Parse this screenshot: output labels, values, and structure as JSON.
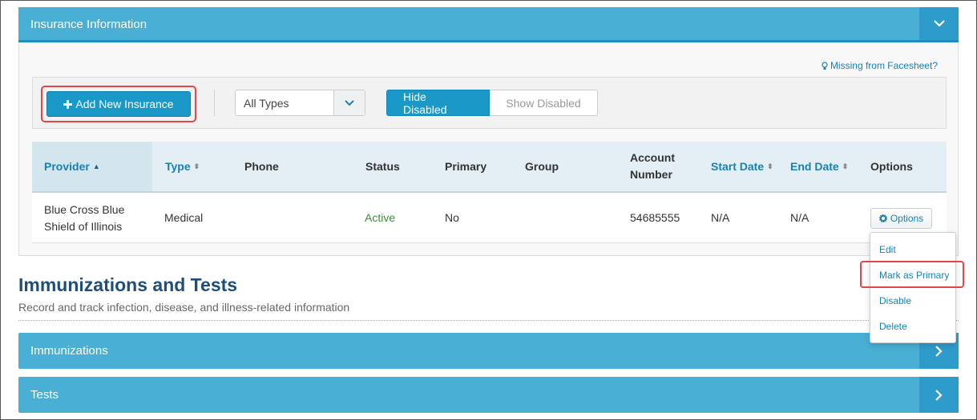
{
  "insurance_panel": {
    "title": "Insurance Information",
    "collapse_icon": "chevron-down-icon",
    "missing_link": "Missing from Facesheet?",
    "add_button_label": "Add New Insurance",
    "type_filter": {
      "selected": "All Types"
    },
    "toggle": {
      "hide_label": "Hide Disabled",
      "show_label": "Show Disabled",
      "active": "hide"
    }
  },
  "insurance_table": {
    "headers": {
      "provider": "Provider",
      "type": "Type",
      "phone": "Phone",
      "status": "Status",
      "primary": "Primary",
      "group": "Group",
      "account_number": "Account Number",
      "start_date": "Start Date",
      "end_date": "End Date",
      "options": "Options"
    },
    "rows": [
      {
        "provider": "Blue Cross Blue Shield of Illinois",
        "type": "Medical",
        "phone": "",
        "status": "Active",
        "primary": "No",
        "group": "",
        "account_number": "54685555",
        "start_date": "N/A",
        "end_date": "N/A",
        "options_label": "Options"
      }
    ]
  },
  "options_menu": {
    "items": [
      "Edit",
      "Mark as Primary",
      "Disable",
      "Delete"
    ],
    "highlighted": "Mark as Primary"
  },
  "immunizations_section": {
    "title": "Immunizations and Tests",
    "subtitle": "Record and track infection, disease, and illness-related information",
    "bars": [
      {
        "title": "Immunizations"
      },
      {
        "title": "Tests"
      }
    ]
  },
  "colors": {
    "header_blue": "#49afd5",
    "button_blue": "#1a98c8",
    "link_blue": "#1a7fb5",
    "active_green": "#3c8c3c",
    "highlight_red": "#e0464a",
    "section_title": "#1f4e79"
  }
}
